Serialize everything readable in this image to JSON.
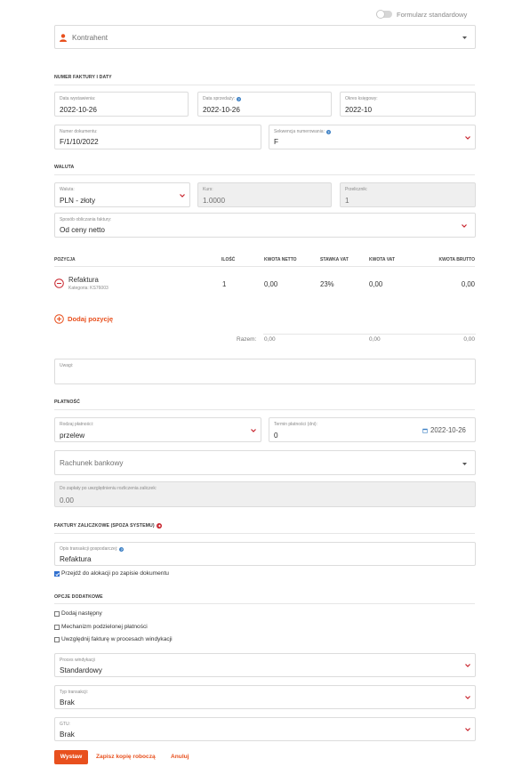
{
  "toggle": {
    "label": "Formularz standardowy"
  },
  "contractor": {
    "placeholder": "Kontrahent"
  },
  "invoice_section": {
    "title": "NUMER FAKTURY I DATY",
    "issue_date": {
      "label": "Data wystawienia:",
      "value": "2022-10-26"
    },
    "sale_date": {
      "label": "Data sprzedaży:",
      "value": "2022-10-26"
    },
    "accounting_period": {
      "label": "Okres księgowy:",
      "value": "2022-10"
    },
    "document_number": {
      "label": "Numer dokumentu:",
      "value": "F/1/10/2022"
    },
    "sequence": {
      "label": "Sekwencja numerowania:",
      "value": "F"
    }
  },
  "currency_section": {
    "title": "WALUTA",
    "currency": {
      "label": "Waluta:",
      "value": "PLN - złoty"
    },
    "rate": {
      "label": "Kurs:",
      "value": "1.0000"
    },
    "multiplier": {
      "label": "Przelicznik:",
      "value": "1"
    },
    "calc_method": {
      "label": "Sposób obliczania faktury:",
      "value": "Od ceny netto"
    }
  },
  "items": {
    "headers": {
      "position": "POZYCJA",
      "qty": "ILOŚĆ",
      "net": "KWOTA NETTO",
      "vat_rate": "STAWKA VAT",
      "vat": "KWOTA VAT",
      "gross": "KWOTA BRUTTO"
    },
    "rows": [
      {
        "name": "Refaktura",
        "category": "Kategoria: KS76003",
        "qty": "1",
        "net": "0,00",
        "vat_rate": "23%",
        "vat": "0,00",
        "gross": "0,00"
      }
    ],
    "add_label": "Dodaj pozycję",
    "total_label": "Razem:",
    "total_net": "0,00",
    "total_vat": "0,00",
    "total_gross": "0,00"
  },
  "notes": {
    "label": "Uwagi:"
  },
  "payment_section": {
    "title": "PŁATNOŚĆ",
    "method": {
      "label": "Rodzaj płatności:",
      "value": "przelew"
    },
    "term": {
      "label": "Termin płatności (dni):",
      "value": "0"
    },
    "due_date": "2022-10-26",
    "bank_account": {
      "placeholder": "Rachunek bankowy"
    },
    "to_pay": {
      "label": "Do zapłaty po uwzględnieniu rozliczenia zaliczek:",
      "value": "0.00"
    }
  },
  "advance_section": {
    "title": "FAKTURY ZALICZKOWE (SPOZA SYSTEMU)",
    "description": {
      "label": "Opis transakcji gospodarczej:",
      "value": "Refaktura"
    },
    "goto_allocation": "Przejdź do alokacji po zapisie dokumentu"
  },
  "options_section": {
    "title": "OPCJE DODATKOWE",
    "checkboxes": [
      "Dodaj następny",
      "Mechanizm podzielonej płatności",
      "Uwzględnij fakturę w procesach windykacji"
    ],
    "collection_process": {
      "label": "Proces windykacji",
      "value": "Standardowy"
    },
    "transaction_type": {
      "label": "Typ transakcji:",
      "value": "Brak"
    },
    "gtu": {
      "label": "GTU:",
      "value": "Brak"
    }
  },
  "actions": {
    "submit": "Wystaw",
    "draft": "Zapisz kopię roboczą",
    "cancel": "Anuluj"
  },
  "colors": {
    "accent": "#e8501e",
    "chevron_red": "#c8232c",
    "checkbox_blue": "#2f6fcf",
    "help_blue": "#3b7fc4"
  }
}
